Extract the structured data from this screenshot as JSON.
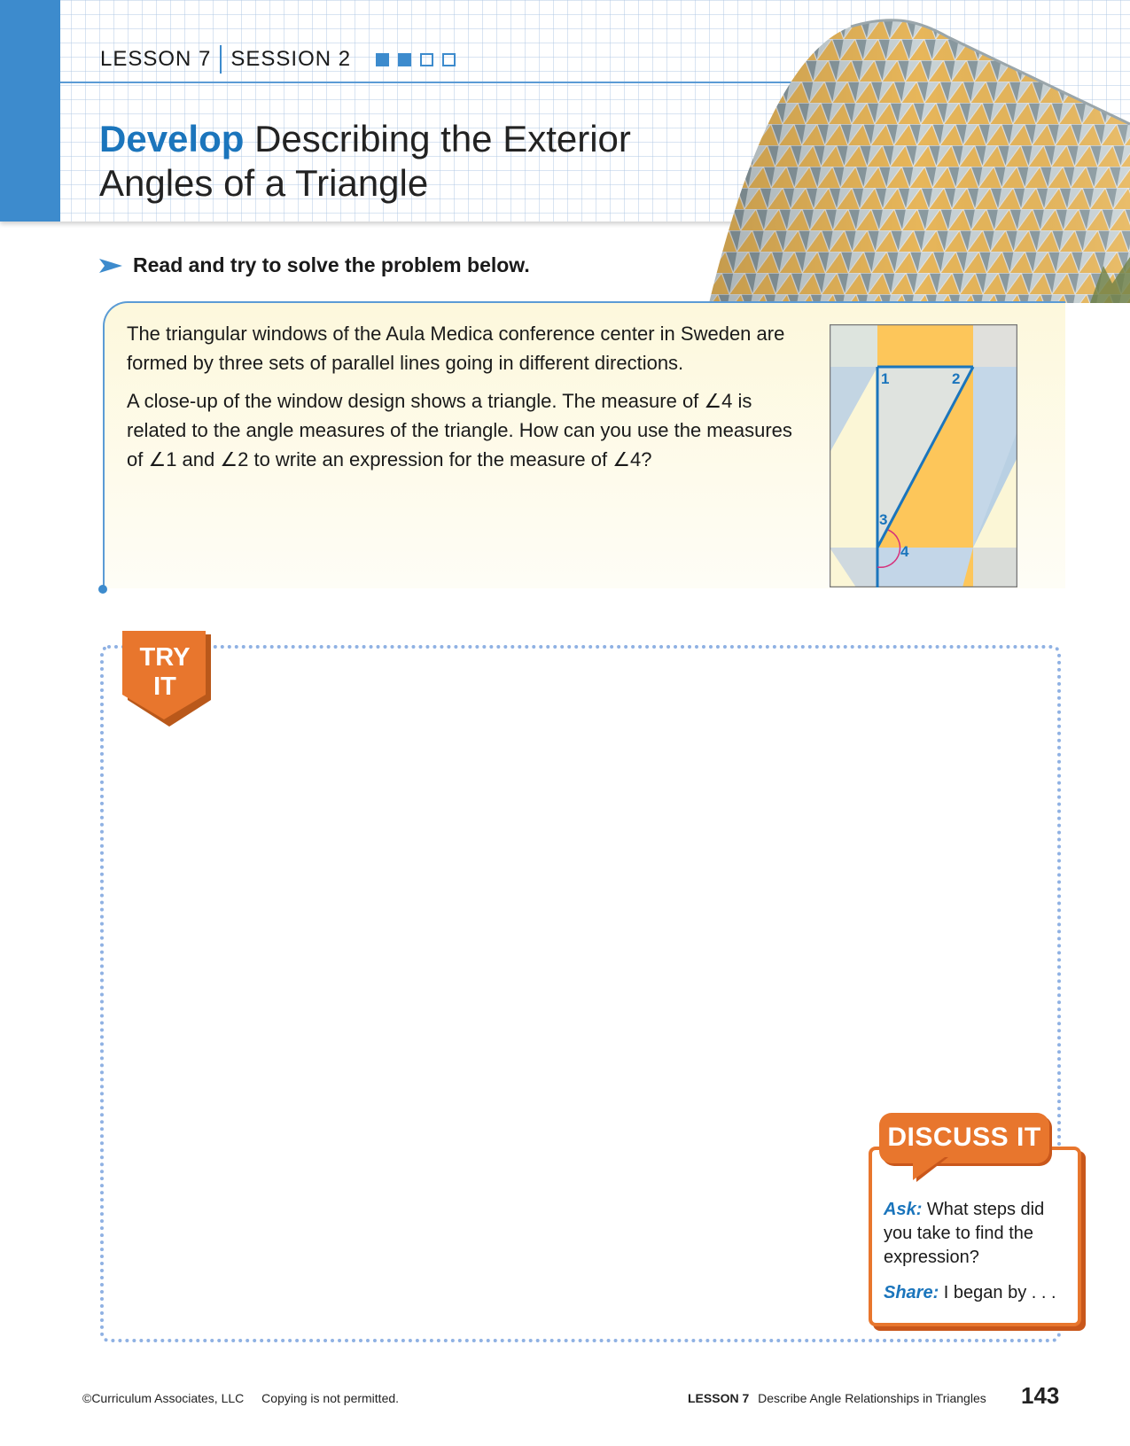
{
  "header": {
    "lesson": "LESSON 7",
    "session": "SESSION 2",
    "progress": {
      "filled": 2,
      "total": 4
    },
    "title_keyword": "Develop",
    "title_line1": "Describing the Exterior",
    "title_line2": "Angles of a Triangle"
  },
  "instruction": "Read and try to solve the problem below.",
  "problem": {
    "paragraph1": "The triangular windows of the Aula Medica conference center in Sweden are formed by three sets of parallel lines going in different directions.",
    "paragraph2_a": "A close-up of the window design shows a triangle. The measure of ",
    "paragraph2_b": "4 is related to the angle measures of the triangle. How can you use the measures of ",
    "paragraph2_c": "1 and ",
    "paragraph2_d": "2 to write an expression for the measure of ",
    "paragraph2_e": "4?",
    "angle_symbol": "∠"
  },
  "diagram": {
    "angle1": "1",
    "angle2": "2",
    "angle3": "3",
    "angle4": "4"
  },
  "try_it": {
    "line1": "TRY",
    "line2": "IT"
  },
  "discuss": {
    "title": "DISCUSS IT",
    "ask_label": "Ask:",
    "ask_text": " What steps did you take to find the expression?",
    "share_label": "Share:",
    "share_text": " I began by . . ."
  },
  "footer": {
    "copyright": "©Curriculum Associates, LLC",
    "notice": "Copying is not permitted.",
    "lesson_label": "LESSON 7",
    "lesson_title": "Describe Angle Relationships in Triangles",
    "page_number": "143"
  },
  "colors": {
    "accent_blue": "#1b75bc",
    "bar_blue": "#3d8bcd",
    "orange": "#e8762d",
    "problem_bg": "#fdf8dc"
  },
  "icons": [
    "arrow-right-icon",
    "building-photo"
  ]
}
